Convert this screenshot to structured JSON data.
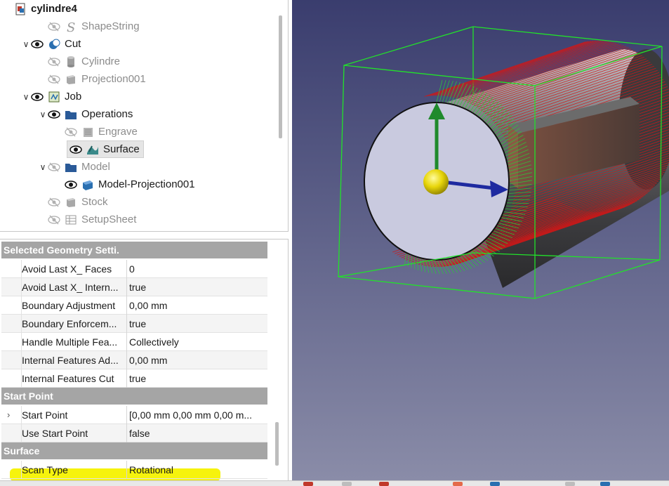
{
  "tree": {
    "items": [
      {
        "label": "cylindre4",
        "eye": "none",
        "chevron": "",
        "icon": "document-icon",
        "style": "bold"
      },
      {
        "label": "ShapeString",
        "eye": "hidden",
        "chevron": "",
        "icon": "shapestring-icon",
        "style": "dim"
      },
      {
        "label": "Cut",
        "eye": "visible",
        "chevron": "⌄",
        "icon": "cut-icon",
        "style": "normal"
      },
      {
        "label": "Cylindre",
        "eye": "hidden",
        "chevron": "",
        "icon": "cylinder-icon",
        "style": "dim"
      },
      {
        "label": "Projection001",
        "eye": "hidden",
        "chevron": "",
        "icon": "box-icon",
        "style": "dim"
      },
      {
        "label": "Job",
        "eye": "visible",
        "chevron": "⌄",
        "icon": "job-icon",
        "style": "normal"
      },
      {
        "label": "Operations",
        "eye": "visible",
        "chevron": "⌄",
        "icon": "folder-icon",
        "style": "normal"
      },
      {
        "label": "Engrave",
        "eye": "hidden",
        "chevron": "",
        "icon": "engrave-icon",
        "style": "dim"
      },
      {
        "label": "Surface",
        "eye": "visible",
        "chevron": "",
        "icon": "surface-icon",
        "style": "selected"
      },
      {
        "label": "Model",
        "eye": "hidden",
        "chevron": "⌄",
        "icon": "folder-icon",
        "style": "dim"
      },
      {
        "label": "Model-Projection001",
        "eye": "visible",
        "chevron": "",
        "icon": "model-icon",
        "style": "normal"
      },
      {
        "label": "Stock",
        "eye": "hidden",
        "chevron": "",
        "icon": "box-icon",
        "style": "dim"
      },
      {
        "label": "SetupSheet",
        "eye": "hidden",
        "chevron": "",
        "icon": "sheet-icon",
        "style": "dim"
      }
    ]
  },
  "properties": {
    "groups": [
      {
        "title": "Selected Geometry Setti.",
        "rows": [
          {
            "name": "Avoid Last X_ Faces",
            "value": "0"
          },
          {
            "name": "Avoid Last X_ Intern...",
            "value": "true"
          },
          {
            "name": "Boundary Adjustment",
            "value": "0,00 mm"
          },
          {
            "name": "Boundary Enforcem...",
            "value": "true"
          },
          {
            "name": "Handle Multiple Fea...",
            "value": "Collectively"
          },
          {
            "name": "Internal Features Ad...",
            "value": "0,00 mm"
          },
          {
            "name": "Internal Features Cut",
            "value": "true"
          }
        ]
      },
      {
        "title": "Start Point",
        "rows": [
          {
            "name": "Start Point",
            "value": "[0,00 mm  0,00 mm  0,00 m...",
            "expandable": true
          },
          {
            "name": "Use Start Point",
            "value": "false"
          }
        ]
      },
      {
        "title": "Surface",
        "rows": [
          {
            "name": "Scan Type",
            "value": "Rotational"
          }
        ]
      }
    ]
  },
  "colors": {
    "highlight": "#f5f200",
    "bounding_box": "#22e22a",
    "toolpath_red": "#d01818",
    "toolpath_green": "#2ac93a",
    "axis_green": "#1f8a2c",
    "axis_blue": "#1e2aa0",
    "origin_yellow": "#e8d60a",
    "header_bg": "#a5a5a5"
  }
}
